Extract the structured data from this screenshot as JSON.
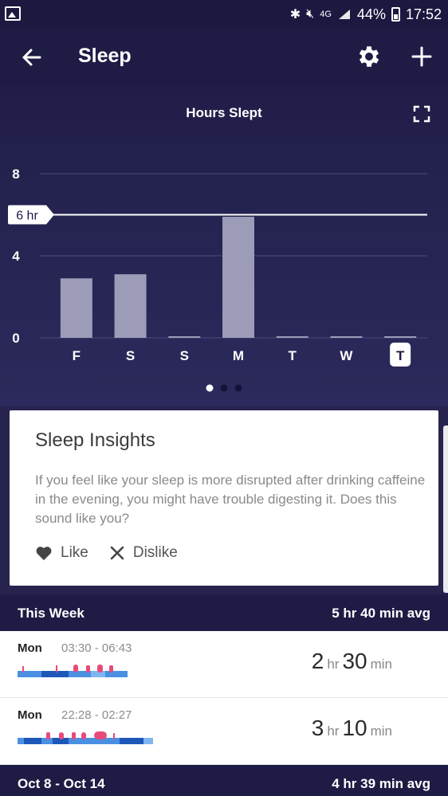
{
  "status_bar": {
    "battery": "44%",
    "time": "17:52",
    "network": "4G"
  },
  "app_bar": {
    "title": "Sleep"
  },
  "chart_data": {
    "type": "bar",
    "title": "Hours Slept",
    "categories": [
      "F",
      "S",
      "S",
      "M",
      "T",
      "W",
      "T"
    ],
    "values": [
      2.9,
      3.1,
      0,
      5.9,
      0,
      0,
      0
    ],
    "ylim": [
      0,
      8
    ],
    "yticks": [
      "0",
      "4",
      "8"
    ],
    "goal": {
      "value": 6,
      "label": "6 hr"
    },
    "highlight_index": 6,
    "colors": {
      "bar": "#9c9bb8",
      "goal_line": "#ffffff"
    }
  },
  "pager": {
    "count": 3,
    "active": 0
  },
  "insights": {
    "title": "Sleep Insights",
    "body": "If you feel like your sleep is more disrupted after drinking caffeine in the evening, you might have trouble digesting it. Does this sound like you?",
    "like": "Like",
    "dislike": "Dislike"
  },
  "this_week": {
    "label": "This Week",
    "avg": "5 hr 40 min avg",
    "logs": [
      {
        "day": "Mon",
        "range": "03:30 - 06:43",
        "hr": "2",
        "hr_unit": "hr",
        "min": "30",
        "min_unit": "min"
      },
      {
        "day": "Mon",
        "range": "22:28 - 02:27",
        "hr": "3",
        "hr_unit": "hr",
        "min": "10",
        "min_unit": "min"
      }
    ]
  },
  "prev_week": {
    "label": "Oct 8 - Oct 14",
    "avg": "4 hr 39 min avg"
  }
}
